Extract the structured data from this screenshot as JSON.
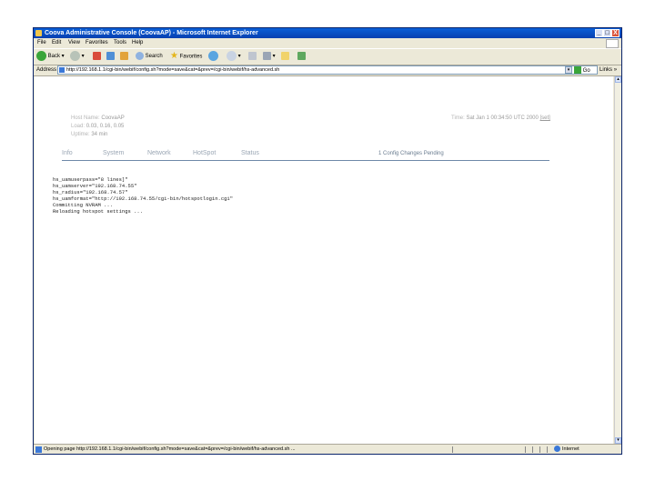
{
  "window": {
    "title": "Coova Administrative Console (CoovaAP) - Microsoft Internet Explorer",
    "controls": [
      "_",
      "□",
      "X"
    ]
  },
  "menu": [
    "File",
    "Edit",
    "View",
    "Favorites",
    "Tools",
    "Help"
  ],
  "toolbar": {
    "back": "Back",
    "search": "Search",
    "favorites": "Favorites"
  },
  "address": {
    "label": "Address",
    "url": "http://192.168.1.1/cgi-bin/webif/config.sh?mode=save&cat=&prev=/cgi-bin/webif/hs-advanced.sh",
    "go": "Go",
    "links": "Links",
    "links_arrow": "»"
  },
  "page": {
    "host_name_label": "Host Name:",
    "host_name": "CoovaAP",
    "load_label": "Load:",
    "load": "0.03, 0.16, 0.05",
    "uptime_label": "Uptime:",
    "uptime": "34 min",
    "time_label": "Time:",
    "time": "Sat Jan 1 00:34:50 UTC 2000",
    "time_set": "[set]",
    "nav": [
      "Info",
      "System",
      "Network",
      "HotSpot",
      "Status"
    ],
    "pending": "1 Config Changes Pending",
    "output": [
      "hs_uamuserpass=\"8 lines]\"",
      "hs_uamserver=\"192.168.74.55\"",
      "hs_radius=\"192.168.74.57\"",
      "hs_uamformat=\"http://192.168.74.55/cgi-bin/hotspotlogin.cgi\"",
      "Committing NVRAM ...",
      "Reloading hotspot settings ..."
    ]
  },
  "status": {
    "text": "Opening page http://192.168.1.1/cgi-bin/webif/config.sh?mode=save&cat=&prev=/cgi-bin/webif/hs-advanced.sh ...",
    "zone": "Internet"
  }
}
